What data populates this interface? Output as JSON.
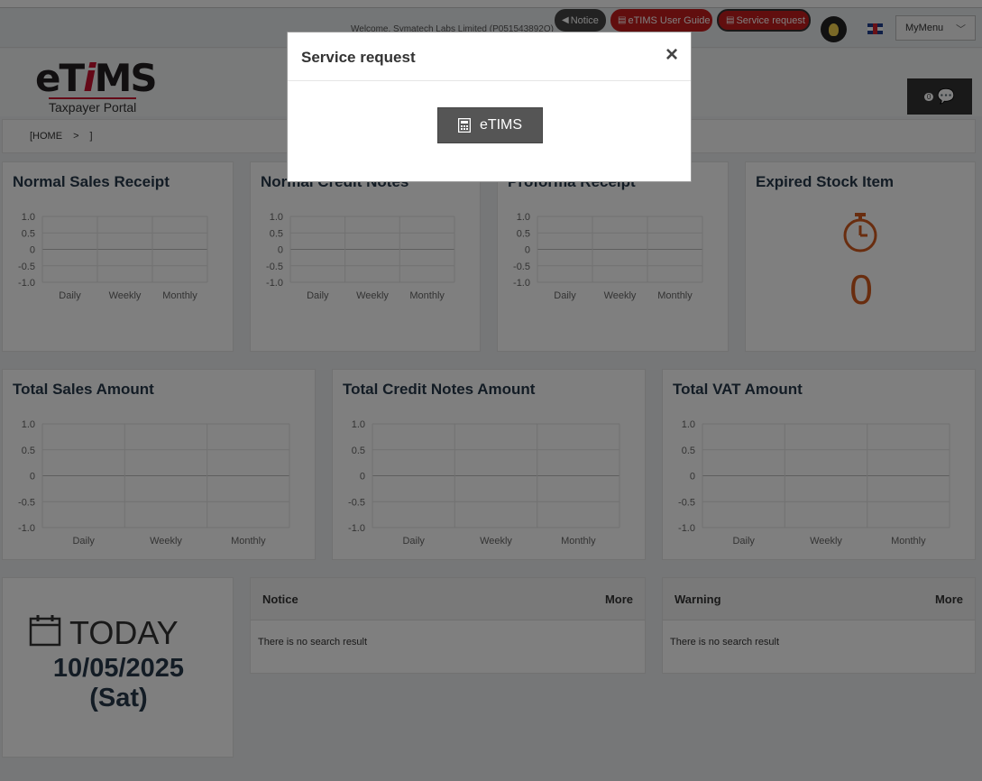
{
  "header": {
    "welcome": "Welcome, Symatech Labs Limited (P051543892Q)",
    "notice_label": "Notice",
    "guide_label": "eTIMS User Guide",
    "service_label": "Service request",
    "menu_label": "MyMenu",
    "chat_count": "0"
  },
  "logo": {
    "main_e": "e",
    "main_t": "T",
    "main_i": "i",
    "main_ms": "MS",
    "sub": "Taxpayer Portal"
  },
  "breadcrumb": {
    "home": "[HOME",
    "sep": ">",
    "end": "]"
  },
  "cards": {
    "normal_sales": "Normal Sales Receipt",
    "normal_credit": "Normal Credit Notes",
    "proforma": "Proforma Receipt",
    "expired": "Expired Stock Item",
    "expired_value": "0",
    "total_sales": "Total Sales Amount",
    "total_credit": "Total Credit Notes Amount",
    "total_vat": "Total VAT Amount"
  },
  "chart_data": [
    {
      "type": "line",
      "title": "Normal Sales Receipt",
      "categories": [
        "Daily",
        "Weekly",
        "Monthly"
      ],
      "y_ticks": [
        "1.0",
        "0.5",
        "0",
        "-0.5",
        "-1.0"
      ],
      "ylim": [
        -1,
        1
      ],
      "series": []
    },
    {
      "type": "line",
      "title": "Normal Credit Notes",
      "categories": [
        "Daily",
        "Weekly",
        "Monthly"
      ],
      "y_ticks": [
        "1.0",
        "0.5",
        "0",
        "-0.5",
        "-1.0"
      ],
      "ylim": [
        -1,
        1
      ],
      "series": []
    },
    {
      "type": "line",
      "title": "Proforma Receipt",
      "categories": [
        "Daily",
        "Weekly",
        "Monthly"
      ],
      "y_ticks": [
        "1.0",
        "0.5",
        "0",
        "-0.5",
        "-1.0"
      ],
      "ylim": [
        -1,
        1
      ],
      "series": []
    },
    {
      "type": "line",
      "title": "Total Sales Amount",
      "categories": [
        "Daily",
        "Weekly",
        "Monthly"
      ],
      "y_ticks": [
        "1.0",
        "0.5",
        "0",
        "-0.5",
        "-1.0"
      ],
      "ylim": [
        -1,
        1
      ],
      "series": []
    },
    {
      "type": "line",
      "title": "Total Credit Notes Amount",
      "categories": [
        "Daily",
        "Weekly",
        "Monthly"
      ],
      "y_ticks": [
        "1.0",
        "0.5",
        "0",
        "-0.5",
        "-1.0"
      ],
      "ylim": [
        -1,
        1
      ],
      "series": []
    },
    {
      "type": "line",
      "title": "Total VAT Amount",
      "categories": [
        "Daily",
        "Weekly",
        "Monthly"
      ],
      "y_ticks": [
        "1.0",
        "0.5",
        "0",
        "-0.5",
        "-1.0"
      ],
      "ylim": [
        -1,
        1
      ],
      "series": []
    }
  ],
  "today": {
    "label": "TODAY",
    "date": "10/05/2025",
    "day": "(Sat)"
  },
  "notice": {
    "title": "Notice",
    "more": "More",
    "empty": "There is no search result"
  },
  "warning": {
    "title": "Warning",
    "more": "More",
    "empty": "There is no search result"
  },
  "modal": {
    "title": "Service request",
    "close": "×",
    "button": "eTIMS"
  },
  "colors": {
    "brand_red": "#c31d1d",
    "accent_orange": "#d25b1e",
    "title_navy": "#27384a"
  }
}
